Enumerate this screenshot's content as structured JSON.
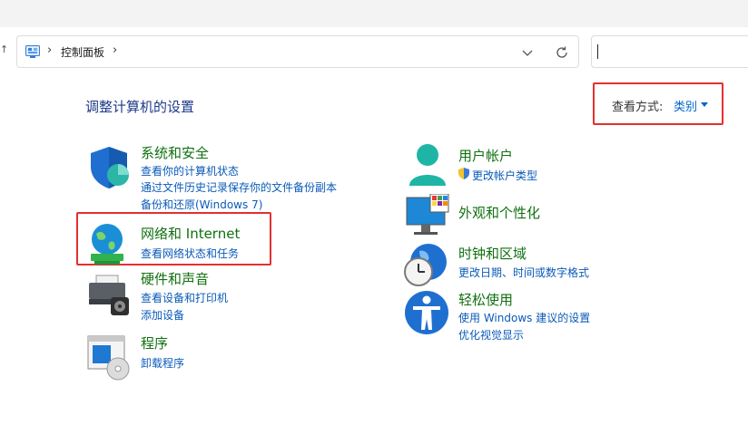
{
  "address": {
    "path": "控制面板",
    "icons": [
      "control-panel-icon",
      "chevron-right-icon",
      "chevron-down-icon",
      "refresh-icon"
    ]
  },
  "search": {
    "value": ""
  },
  "page": {
    "title": "调整计算机的设置"
  },
  "view": {
    "label": "查看方式:",
    "value": "类别"
  },
  "categories": {
    "system": {
      "title": "系统和安全",
      "links": [
        "查看你的计算机状态",
        "通过文件历史记录保存你的文件备份副本",
        "备份和还原(Windows 7)"
      ]
    },
    "network": {
      "title": "网络和 Internet",
      "links": [
        "查看网络状态和任务"
      ]
    },
    "hardware": {
      "title": "硬件和声音",
      "links": [
        "查看设备和打印机",
        "添加设备"
      ]
    },
    "programs": {
      "title": "程序",
      "links": [
        "卸载程序"
      ]
    },
    "users": {
      "title": "用户帐户",
      "links": [
        "更改帐户类型"
      ]
    },
    "appearance": {
      "title": "外观和个性化",
      "links": []
    },
    "clock": {
      "title": "时钟和区域",
      "links": [
        "更改日期、时间或数字格式"
      ]
    },
    "ease": {
      "title": "轻松使用",
      "links": [
        "使用 Windows 建议的设置",
        "优化视觉显示"
      ]
    }
  },
  "colors": {
    "category_title": "#107010",
    "link": "#0a5ab8",
    "highlight_border": "#e23030",
    "page_title": "#1e3a8a"
  }
}
